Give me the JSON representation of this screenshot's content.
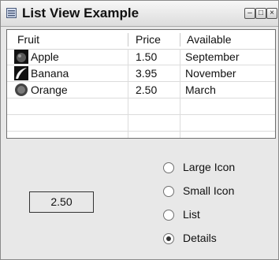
{
  "window": {
    "title": "List View Example",
    "minimize_label": "–",
    "maximize_label": "□",
    "close_label": "×"
  },
  "listview": {
    "columns": [
      "Fruit",
      "Price",
      "Available"
    ],
    "rows": [
      {
        "name": "Apple",
        "price": "1.50",
        "available": "September",
        "icon": "apple-icon"
      },
      {
        "name": "Banana",
        "price": "3.95",
        "available": "November",
        "icon": "banana-icon"
      },
      {
        "name": "Orange",
        "price": "2.50",
        "available": "March",
        "icon": "orange-icon"
      }
    ]
  },
  "selected_price": "2.50",
  "view_options": {
    "items": [
      "Large Icon",
      "Small Icon",
      "List",
      "Details"
    ],
    "selected": "Details"
  }
}
